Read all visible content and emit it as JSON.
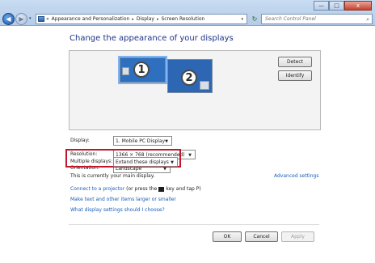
{
  "window": {
    "minimize_glyph": "—",
    "maximize_glyph": "□",
    "close_glyph": "x"
  },
  "nav": {
    "back_glyph": "◀",
    "forward_glyph": "▶",
    "history_glyph": "▾"
  },
  "address": {
    "prefix": "«",
    "crumbs": [
      "Appearance and Personalization",
      "Display",
      "Screen Resolution"
    ],
    "separator": "▸",
    "dropdown_glyph": "▾",
    "refresh_glyph": "↻"
  },
  "search": {
    "placeholder": "Search Control Panel",
    "icon": "⌕"
  },
  "page": {
    "title": "Change the appearance of your displays"
  },
  "monitors": [
    {
      "number": "1",
      "selected": true
    },
    {
      "number": "2",
      "selected": false
    }
  ],
  "buttons": {
    "detect": "Detect",
    "identify": "Identify",
    "ok": "OK",
    "cancel": "Cancel",
    "apply": "Apply"
  },
  "settings": {
    "display": {
      "label": "Display:",
      "value": "1. Mobile PC Display"
    },
    "resolution": {
      "label": "Resolution:",
      "value": "1366 × 768 (recommended)"
    },
    "orientation": {
      "label": "Orientation:",
      "value": "Landscape"
    },
    "multiple": {
      "label": "Multiple displays:",
      "value": "Extend these displays"
    }
  },
  "status": "This is currently your main display.",
  "advanced_link": "Advanced settings",
  "links": {
    "projector": "Connect to a projector",
    "projector_hint_before": "(or press the",
    "projector_hint_after": "key and tap P)",
    "text_size": "Make text and other items larger or smaller",
    "which_settings": "What display settings should I choose?"
  },
  "colors": {
    "highlight": "#c0152a",
    "link": "#1a5cb8",
    "title": "#1e3287",
    "monitor": "#2e6fc0"
  }
}
